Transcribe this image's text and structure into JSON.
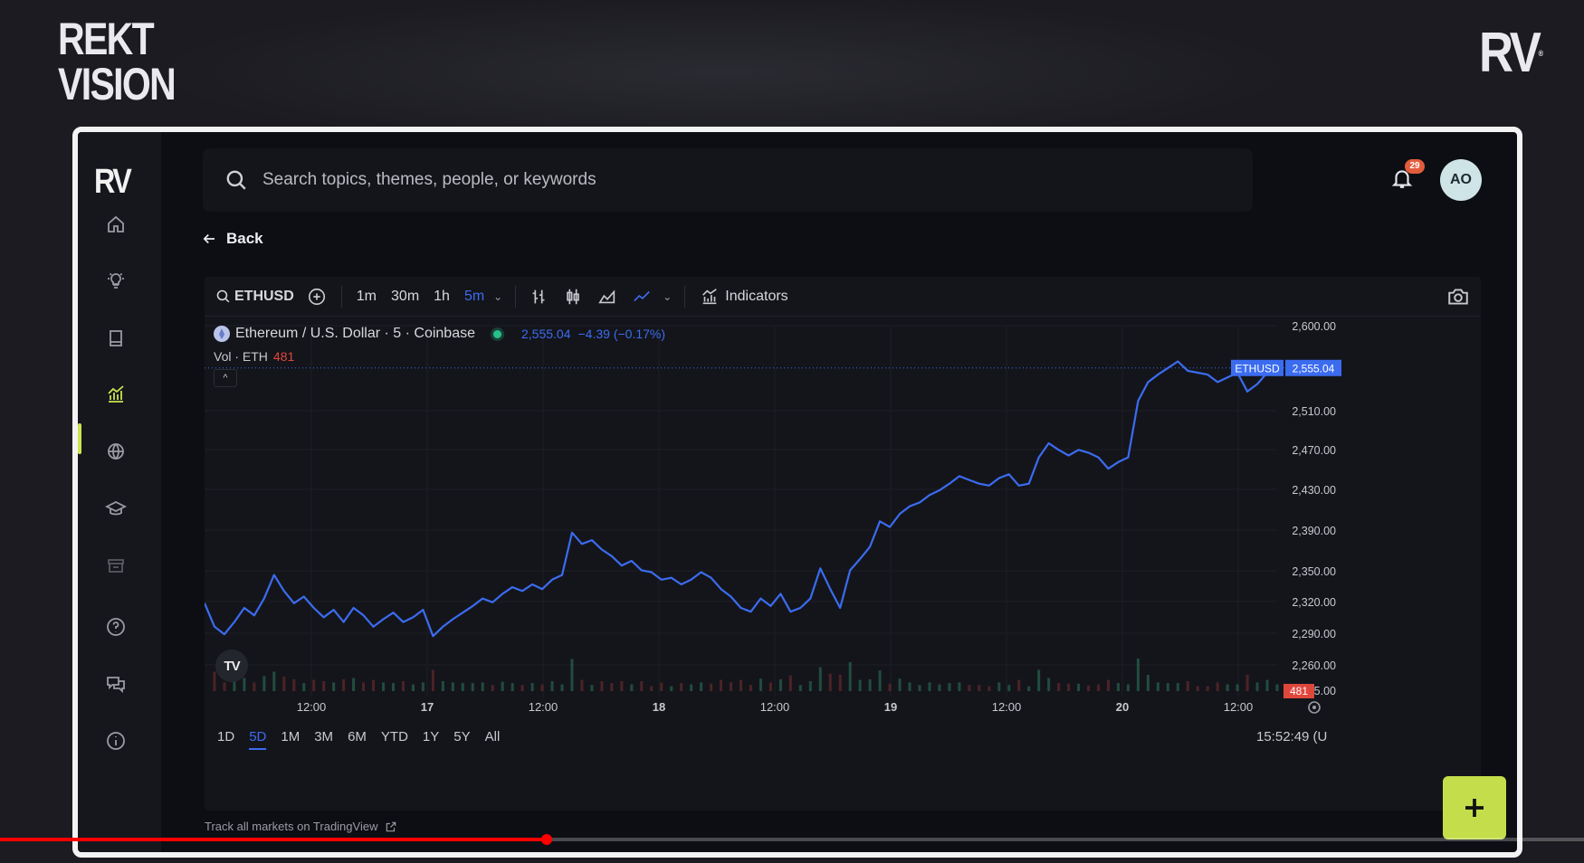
{
  "brand": {
    "left_line1": "REKT",
    "left_line2": "VISION",
    "right": "RV",
    "right_mark": "®"
  },
  "sidebar": {
    "logo": "RV",
    "items": [
      {
        "icon": "home-icon"
      },
      {
        "icon": "lightbulb-icon"
      },
      {
        "icon": "book-icon"
      },
      {
        "icon": "chart-icon",
        "active": true
      },
      {
        "icon": "globe-icon"
      },
      {
        "icon": "graduation-cap-icon"
      },
      {
        "icon": "archive-icon"
      },
      {
        "icon": "help-icon"
      },
      {
        "icon": "chat-icon"
      },
      {
        "icon": "info-icon"
      }
    ],
    "active_color": "#c9e54f"
  },
  "search": {
    "placeholder": "Search topics, themes, people, or keywords"
  },
  "header": {
    "notification_count": "29",
    "avatar_initials": "AO"
  },
  "back": {
    "label": "Back"
  },
  "toolbar": {
    "symbol": "ETHUSD",
    "intervals": [
      "1m",
      "30m",
      "1h",
      "5m"
    ],
    "active_interval": "5m",
    "indicators_label": "Indicators"
  },
  "legend": {
    "title": "Ethereum / U.S. Dollar · 5 · Coinbase",
    "price": "2,555.04",
    "change": "−4.39 (−0.17%)",
    "vol_label": "Vol · ETH",
    "vol_value": "481"
  },
  "ranges": [
    "1D",
    "5D",
    "1M",
    "3M",
    "6M",
    "YTD",
    "1Y",
    "5Y",
    "All"
  ],
  "active_range": "5D",
  "clock": "15:52:49 (U",
  "footer": {
    "track_label": "Track all markets on TradingView"
  },
  "colors": {
    "line": "#3b6cf0",
    "volume_down": "#e0473c",
    "accent": "#c4dd4a"
  },
  "video": {
    "progress": 0.345
  },
  "chart_data": {
    "type": "line",
    "x_tick_labels": [
      "12:00",
      "17",
      "12:00",
      "18",
      "12:00",
      "19",
      "12:00",
      "20",
      "12:00"
    ],
    "y_tick_labels": [
      "2,600.00",
      "2,510.00",
      "2,470.00",
      "2,430.00",
      "2,390.00",
      "2,350.00",
      "2,320.00",
      "2,290.00",
      "2,260.00"
    ],
    "last_price_label": "2,555.04",
    "last_price_tag": "ETHUSD",
    "last_price": 2555.04,
    "volume_tag": "481",
    "volume_axis_label_tail": "5.00",
    "ylim": [
      2225,
      2600
    ],
    "series": [
      {
        "values": [
          2305,
          2280,
          2272,
          2285,
          2300,
          2292,
          2310,
          2335,
          2318,
          2305,
          2312,
          2300,
          2290,
          2298,
          2285,
          2300,
          2292,
          2280,
          2288,
          2295,
          2285,
          2290,
          2298,
          2270,
          2280,
          2288,
          2295,
          2302,
          2310,
          2306,
          2315,
          2322,
          2318,
          2325,
          2320,
          2330,
          2335,
          2380,
          2368,
          2372,
          2362,
          2355,
          2345,
          2350,
          2340,
          2338,
          2330,
          2332,
          2325,
          2330,
          2338,
          2332,
          2320,
          2312,
          2300,
          2296,
          2310,
          2302,
          2315,
          2296,
          2300,
          2310,
          2342,
          2320,
          2300,
          2340,
          2352,
          2365,
          2392,
          2386,
          2400,
          2408,
          2412,
          2420,
          2425,
          2432,
          2440,
          2436,
          2432,
          2430,
          2438,
          2442,
          2430,
          2432,
          2460,
          2475,
          2468,
          2462,
          2468,
          2465,
          2460,
          2448,
          2455,
          2460,
          2520,
          2540,
          2548,
          2555,
          2562,
          2552,
          2550,
          2548,
          2540,
          2545,
          2550,
          2530,
          2538,
          2550,
          2555
        ]
      }
    ]
  }
}
